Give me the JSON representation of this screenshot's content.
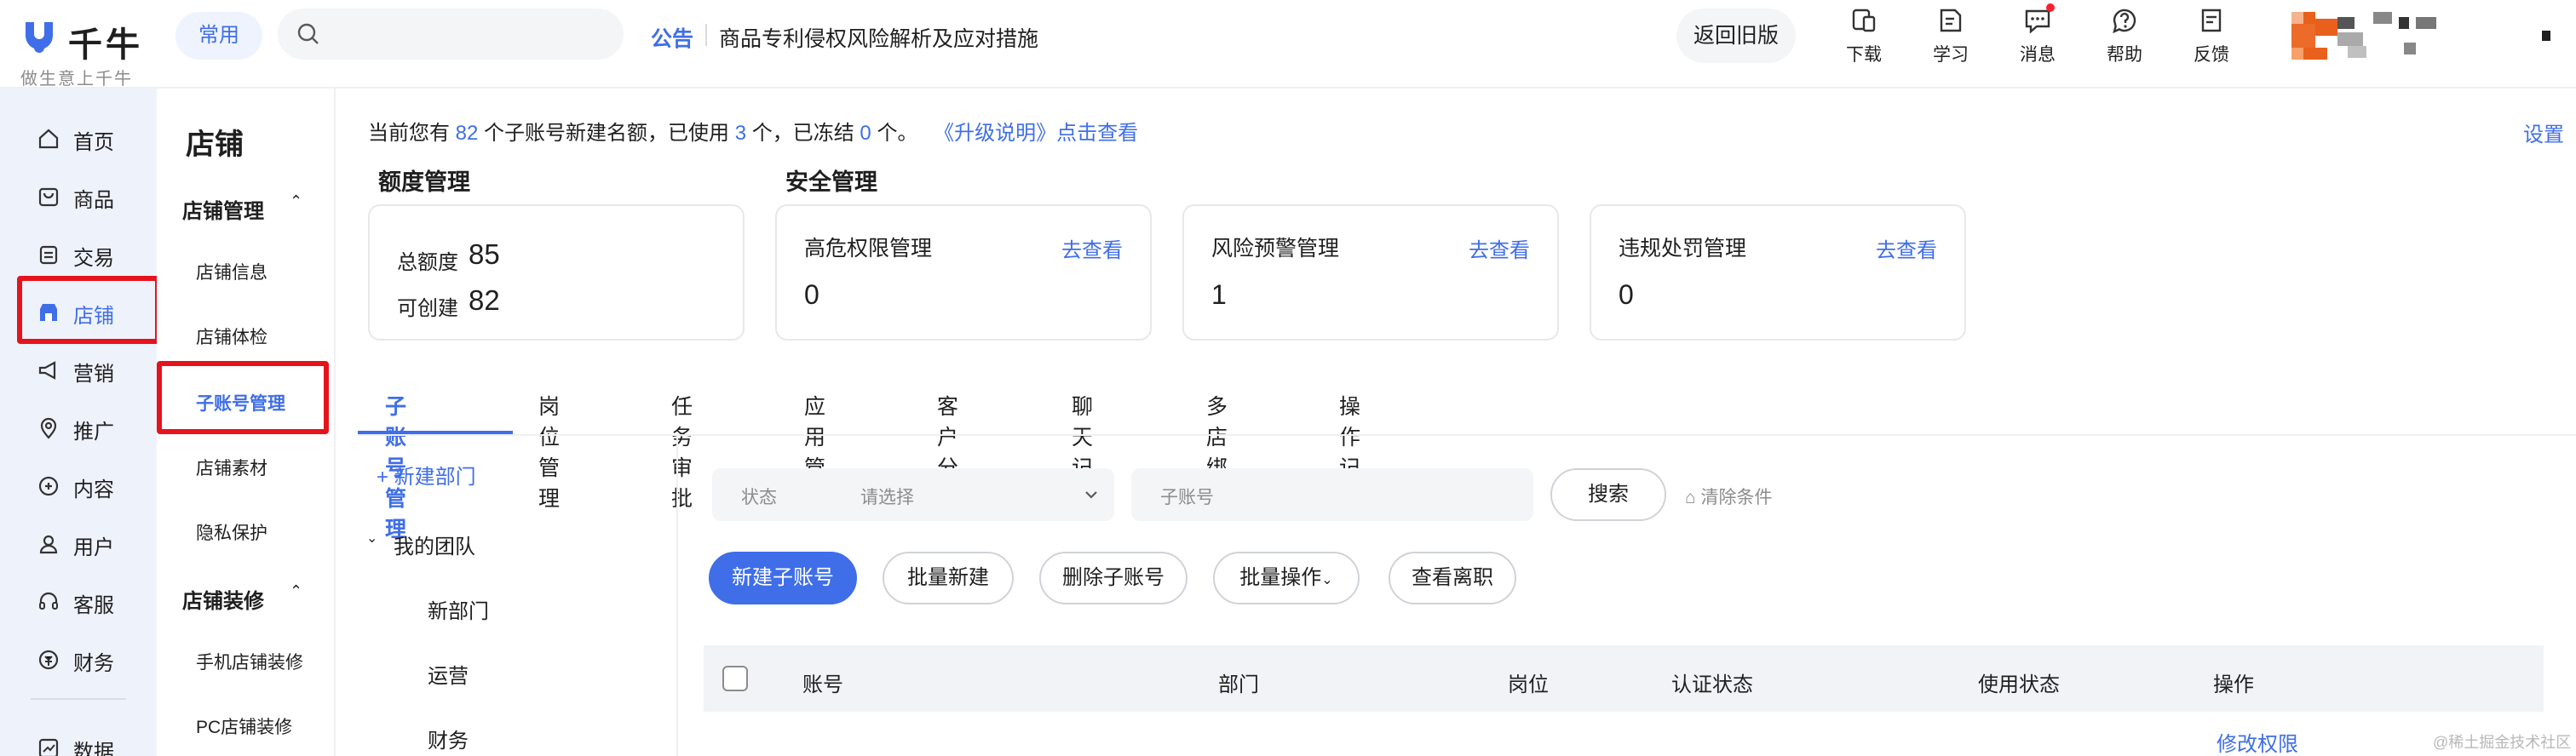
{
  "topbar": {
    "logo_text": "千牛",
    "logo_sub": "做生意上千牛",
    "common_label": "常用",
    "search_placeholder": "",
    "notice_label": "公告",
    "notice_text": "商品专利侵权风险解析及应对措施",
    "return_label": "返回旧版",
    "tools": [
      "下载",
      "学习",
      "消息",
      "帮助",
      "反馈"
    ]
  },
  "leftnav": {
    "items": [
      {
        "label": "首页",
        "icon": "home-icon"
      },
      {
        "label": "商品",
        "icon": "goods-icon"
      },
      {
        "label": "交易",
        "icon": "trade-icon"
      },
      {
        "label": "店铺",
        "icon": "shop-icon",
        "active": true
      },
      {
        "label": "营销",
        "icon": "megaphone-icon"
      },
      {
        "label": "推广",
        "icon": "location-icon"
      },
      {
        "label": "内容",
        "icon": "content-icon"
      },
      {
        "label": "用户",
        "icon": "user-icon"
      },
      {
        "label": "客服",
        "icon": "headset-icon"
      },
      {
        "label": "财务",
        "icon": "finance-icon"
      },
      {
        "label": "数据",
        "icon": "data-icon"
      }
    ]
  },
  "subnav": {
    "title": "店铺",
    "groups": [
      {
        "label": "店铺管理",
        "items": [
          "店铺信息",
          "店铺体检",
          "子账号管理",
          "店铺素材",
          "隐私保护"
        ]
      },
      {
        "label": "店铺装修",
        "items": [
          "手机店铺装修",
          "PC店铺装修"
        ]
      }
    ],
    "active_item": "子账号管理"
  },
  "summary": {
    "prefix": "当前您有",
    "total": "82",
    "mid1": "个子账号新建名额，已使用",
    "used": "3",
    "mid2": "个，已冻结",
    "frozen": "0",
    "suffix": "个。",
    "upgrade_link": "《升级说明》点击查看",
    "settings": "设置"
  },
  "quota": {
    "title": "额度管理",
    "total_label": "总额度",
    "total_value": "85",
    "creatable_label": "可创建",
    "creatable_value": "82"
  },
  "security": {
    "title": "安全管理",
    "cards": [
      {
        "title": "高危权限管理",
        "link": "去查看",
        "value": "0"
      },
      {
        "title": "风险预警管理",
        "link": "去查看",
        "value": "1"
      },
      {
        "title": "违规处罚管理",
        "link": "去查看",
        "value": "0"
      }
    ]
  },
  "tabs": [
    "子账号管理",
    "岗位管理",
    "任务审批",
    "应用管理",
    "客户分流",
    "聊天记录",
    "多店绑定",
    "操作记录"
  ],
  "tree": {
    "new_dept": "+ 新建部门",
    "team": "我的团队",
    "children": [
      "新部门",
      "运营",
      "财务"
    ]
  },
  "filters": {
    "status_label": "状态",
    "status_placeholder": "请选择",
    "account_placeholder": "子账号",
    "search": "搜索",
    "clear": "清除条件"
  },
  "actions": [
    "新建子账号",
    "批量新建",
    "删除子账号",
    "批量操作",
    "查看离职"
  ],
  "table": {
    "columns": [
      "账号",
      "部门",
      "岗位",
      "认证状态",
      "使用状态",
      "操作"
    ],
    "row_action": "修改权限"
  },
  "watermark": "@稀土掘金技术社区",
  "colors": {
    "accent": "#3f6ee8",
    "highlight": "#e5141c",
    "nav_bg": "#eef2fb"
  }
}
